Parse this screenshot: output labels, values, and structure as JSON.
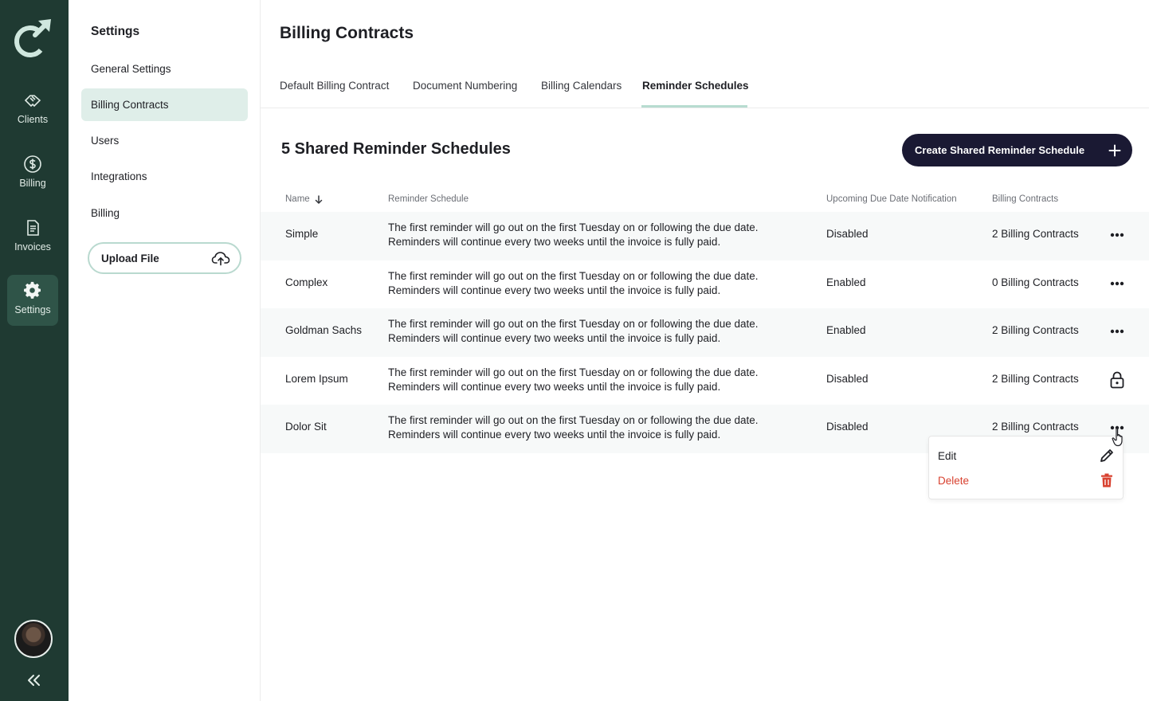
{
  "rail": {
    "items": [
      {
        "label": "Clients",
        "icon": "handshake-icon"
      },
      {
        "label": "Billing",
        "icon": "dollar-circle-icon"
      },
      {
        "label": "Invoices",
        "icon": "invoice-document-icon"
      },
      {
        "label": "Settings",
        "icon": "gear-icon"
      }
    ],
    "active": "Settings"
  },
  "settings_nav": {
    "title": "Settings",
    "items": [
      "General Settings",
      "Billing Contracts",
      "Users",
      "Integrations",
      "Billing"
    ],
    "active": "Billing Contracts",
    "upload_label": "Upload File"
  },
  "main": {
    "title": "Billing Contracts",
    "tabs": [
      "Default Billing Contract",
      "Document Numbering",
      "Billing Calendars",
      "Reminder Schedules"
    ],
    "active_tab": "Reminder Schedules",
    "section_title": "5 Shared Reminder Schedules",
    "create_label": "Create Shared Reminder Schedule"
  },
  "table": {
    "headers": {
      "name": "Name",
      "schedule": "Reminder Schedule",
      "notification": "Upcoming Due Date Notification",
      "contracts": "Billing Contracts"
    },
    "rows": [
      {
        "name": "Simple",
        "line1": "The first reminder will go out on the first Tuesday on or following the due date.",
        "line2": "Reminders will continue every two weeks until the invoice is fully paid.",
        "notification": "Disabled",
        "contracts": "2 Billing Contracts",
        "action": "more-icon"
      },
      {
        "name": "Complex",
        "line1": "The first reminder will go out on the first Tuesday on or following the due date.",
        "line2": "Reminders will continue every two weeks until the invoice is fully paid.",
        "notification": "Enabled",
        "contracts": "0 Billing Contracts",
        "action": "more-icon"
      },
      {
        "name": "Goldman Sachs",
        "line1": "The first reminder will go out on the first Tuesday on or following the due date.",
        "line2": "Reminders will continue every two weeks until the invoice is fully paid.",
        "notification": "Enabled",
        "contracts": "2 Billing Contracts",
        "action": "more-icon"
      },
      {
        "name": "Lorem Ipsum",
        "line1": "The first reminder will go out on the first Tuesday on or following the due date.",
        "line2": "Reminders will continue every two weeks until the invoice is fully paid.",
        "notification": "Disabled",
        "contracts": "2 Billing Contracts",
        "action": "lock-icon"
      },
      {
        "name": "Dolor Sit",
        "line1": "The first reminder will go out on the first Tuesday on or following the due date.",
        "line2": "Reminders will continue every two weeks until the invoice is fully paid.",
        "notification": "Disabled",
        "contracts": "2 Billing Contracts",
        "action": "more-icon"
      }
    ]
  },
  "context_menu": {
    "edit_label": "Edit",
    "delete_label": "Delete"
  },
  "colors": {
    "rail_bg": "#1f3a32",
    "rail_active": "#2f5448",
    "nav_active_bg": "#dfeee9",
    "tab_underline": "#b7dcd0",
    "primary_button": "#1a1933",
    "delete_red": "#d8412f"
  }
}
